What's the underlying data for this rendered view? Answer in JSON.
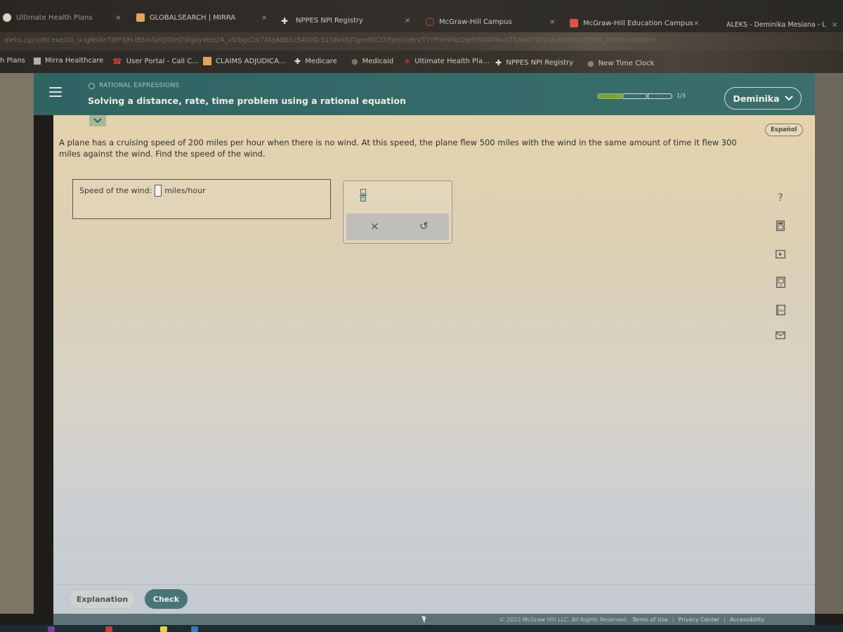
{
  "browser": {
    "tabs": [
      {
        "label": "Ultimate Health Plans",
        "icon": "ultimate-health-favicon",
        "active": false
      },
      {
        "label": "GLOBALSEARCH | MIRRA",
        "icon": "mirra-favicon",
        "active": false
      },
      {
        "label": "NPPES NPI Registry",
        "icon": "nppes-favicon",
        "active": false
      },
      {
        "label": "McGraw-Hill Campus",
        "icon": "mcgraw-campus-favicon",
        "active": false
      },
      {
        "label": "McGraw-Hill Education Campus",
        "icon": "mcgraw-education-favicon",
        "active": false
      },
      {
        "label": "ALEKS - Deminika Mesiana - L",
        "icon": "aleks-favicon",
        "active": true
      }
    ],
    "close_glyph": "×",
    "url": "aleks.cgi/x/Isl.exe/1o_u-IgNslkr7j8P3jH-lBSmSHQlfbH2sfgdyVelz24_xSrbgiCtk7AtqABb1cS40zD-S1OBrkKJTgeofGCtYPjecUu9rVTYYPrkHHlzQqHrFAGkfKvo71o6w7QYjhavbSPXtx-YCjsn_7mMmrq#item",
    "bookmarks": [
      {
        "label": "h Plans",
        "icon": ""
      },
      {
        "label": "Mirra Healthcare",
        "icon": "mirra-icon"
      },
      {
        "label": "User Portal - Call C...",
        "icon": "phone-icon"
      },
      {
        "label": "CLAIMS ADJUDICA...",
        "icon": "claims-icon"
      },
      {
        "label": "Medicare",
        "icon": "caduceus-icon"
      },
      {
        "label": "Medicaid",
        "icon": "globe-icon"
      },
      {
        "label": "Ultimate Health Pla...",
        "icon": "ultimate-health-icon"
      },
      {
        "label": "NPPES NPI Registry",
        "icon": "caduceus-icon"
      },
      {
        "label": "New Time Clock",
        "icon": "globe-icon"
      }
    ]
  },
  "header": {
    "topic": "RATIONAL EXPRESSIONS",
    "lesson_title": "Solving a distance, rate, time problem using a rational equation",
    "progress": {
      "completed": 1,
      "total": 3,
      "label": "1/3"
    },
    "user_name": "Deminika",
    "menu_icon": "hamburger-icon"
  },
  "content": {
    "language_button": "Español",
    "problem_text": "A plane has a cruising speed of 200 miles per hour when there is no wind. At this speed, the plane flew 500 miles with the wind in the same amount of time it flew 300 miles against the wind. Find the speed of the wind.",
    "answer": {
      "prefix": "Speed of the wind:",
      "value": "",
      "suffix": "miles/hour"
    },
    "keypad": {
      "fraction_icon": "fraction-icon",
      "clear_glyph": "×",
      "undo_glyph": "↺"
    },
    "tools": [
      {
        "name": "help",
        "glyph": "?"
      },
      {
        "name": "calculator"
      },
      {
        "name": "video"
      },
      {
        "name": "ebook"
      },
      {
        "name": "dictionary"
      },
      {
        "name": "message"
      }
    ],
    "buttons": {
      "explanation": "Explanation",
      "check": "Check"
    }
  },
  "footer": {
    "copyright": "© 2022 McGraw Hill LLC. All Rights Reserved.",
    "links": [
      "Terms of Use",
      "Privacy Center",
      "Accessibility"
    ],
    "separator": "|"
  }
}
